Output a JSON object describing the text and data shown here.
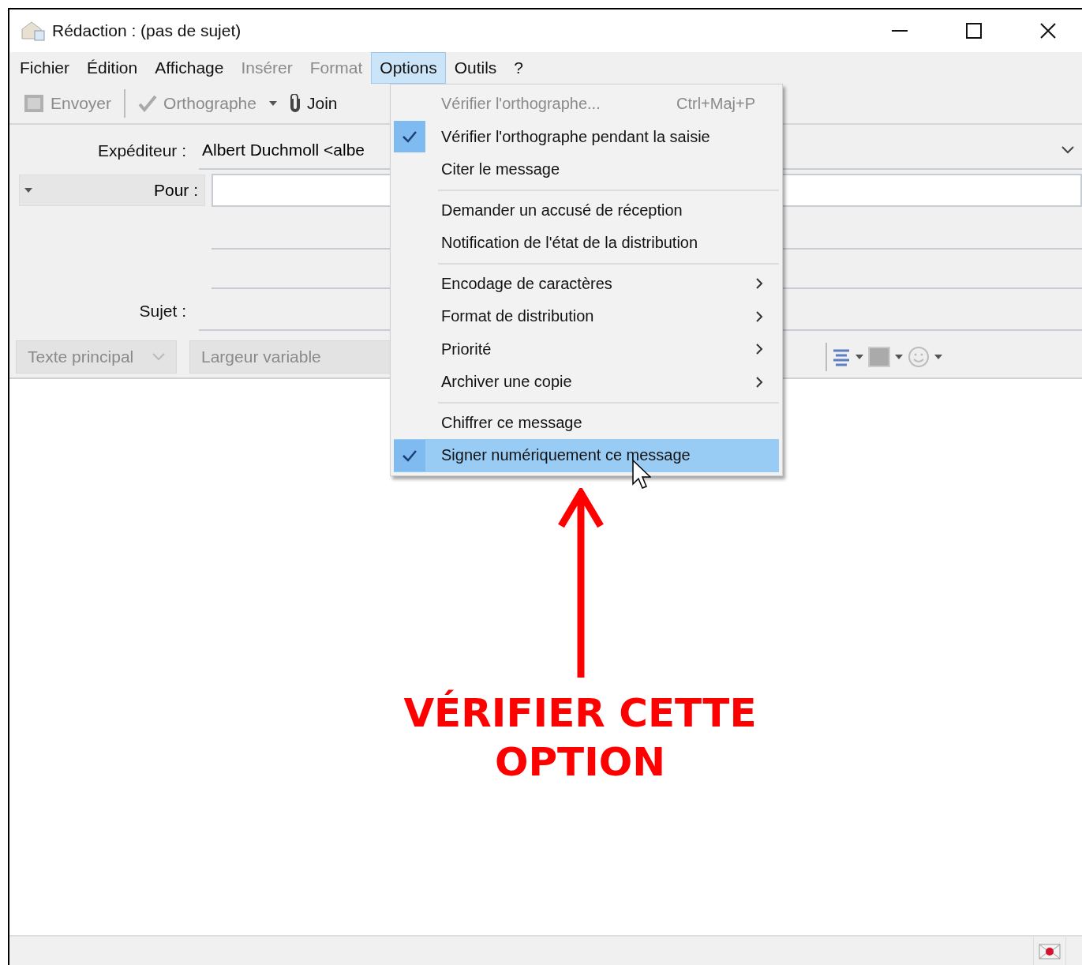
{
  "window": {
    "title": "Rédaction : (pas de sujet)"
  },
  "menu_bar": [
    {
      "label": "Fichier",
      "disabled": false,
      "selected": false
    },
    {
      "label": "Édition",
      "disabled": false,
      "selected": false
    },
    {
      "label": "Affichage",
      "disabled": false,
      "selected": false
    },
    {
      "label": "Insérer",
      "disabled": true,
      "selected": false
    },
    {
      "label": "Format",
      "disabled": true,
      "selected": false
    },
    {
      "label": "Options",
      "disabled": false,
      "selected": true
    },
    {
      "label": "Outils",
      "disabled": false,
      "selected": false
    },
    {
      "label": "?",
      "disabled": false,
      "selected": false
    }
  ],
  "toolbar": [
    {
      "kind": "send",
      "label": "Envoyer",
      "disabled": true
    },
    {
      "kind": "spell",
      "label": "Orthographe",
      "disabled": true
    },
    {
      "kind": "attach",
      "label": "Join",
      "disabled": false
    }
  ],
  "header": {
    "sender_label": "Expéditeur :",
    "sender_value": "Albert Duchmoll <albe",
    "to_label": "Pour :",
    "subject_label": "Sujet :"
  },
  "format_bar": {
    "paragraph_style": "Texte principal",
    "font": "Largeur variable"
  },
  "options_menu": [
    {
      "kind": "item",
      "label": "Vérifier l'orthographe...",
      "shortcut": "Ctrl+Maj+P",
      "disabled": true,
      "checked": false,
      "submenu": false,
      "highlighted": false
    },
    {
      "kind": "item",
      "label": "Vérifier l'orthographe pendant la saisie",
      "disabled": false,
      "checked": true,
      "submenu": false,
      "highlighted": false
    },
    {
      "kind": "item",
      "label": "Citer le message",
      "disabled": false,
      "checked": false,
      "submenu": false,
      "highlighted": false
    },
    {
      "kind": "separator"
    },
    {
      "kind": "item",
      "label": "Demander un accusé de réception",
      "disabled": false,
      "checked": false,
      "submenu": false,
      "highlighted": false
    },
    {
      "kind": "item",
      "label": "Notification de l'état de la distribution",
      "disabled": false,
      "checked": false,
      "submenu": false,
      "highlighted": false
    },
    {
      "kind": "separator"
    },
    {
      "kind": "item",
      "label": "Encodage de caractères",
      "disabled": false,
      "checked": false,
      "submenu": true,
      "highlighted": false
    },
    {
      "kind": "item",
      "label": "Format de distribution",
      "disabled": false,
      "checked": false,
      "submenu": true,
      "highlighted": false
    },
    {
      "kind": "item",
      "label": "Priorité",
      "disabled": false,
      "checked": false,
      "submenu": true,
      "highlighted": false
    },
    {
      "kind": "item",
      "label": "Archiver une copie",
      "disabled": false,
      "checked": false,
      "submenu": true,
      "highlighted": false
    },
    {
      "kind": "separator"
    },
    {
      "kind": "item",
      "label": "Chiffrer ce message",
      "disabled": false,
      "checked": false,
      "submenu": false,
      "highlighted": false
    },
    {
      "kind": "item",
      "label": "Signer numériquement ce message",
      "disabled": false,
      "checked": true,
      "submenu": false,
      "highlighted": true
    }
  ],
  "annotation": {
    "text": "VÉRIFIER CETTE OPTION"
  }
}
